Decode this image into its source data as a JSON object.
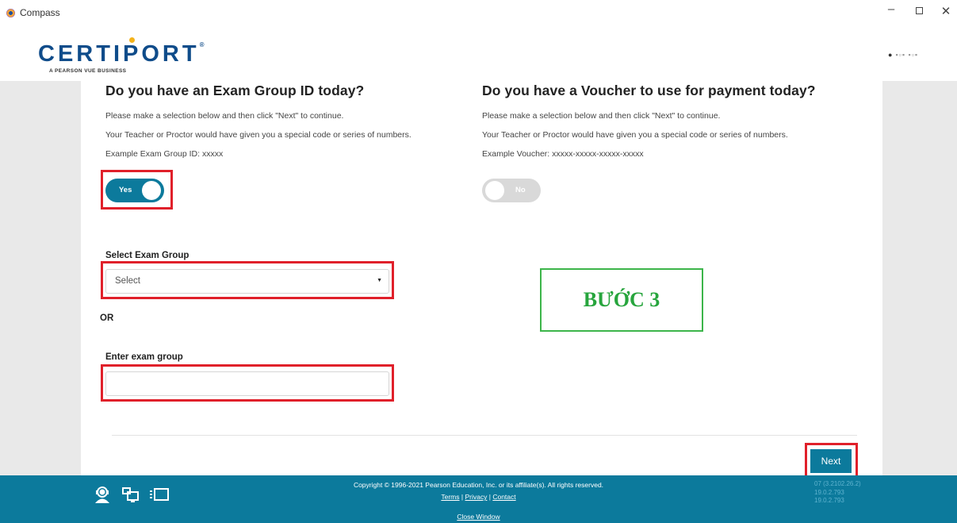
{
  "window": {
    "title": "Compass",
    "minimize_label": "–",
    "close_label": "✕"
  },
  "header": {
    "logo_text": "CERTIPORT",
    "logo_registered": "®",
    "logo_subtitle": "A PEARSON VUE BUSINESS",
    "user_name": "▪▫▪ ▪▫▪"
  },
  "exam_group": {
    "title": "Do you have an Exam Group ID today?",
    "instruction": "Please make a selection below and then click \"Next\" to continue.",
    "hint": "Your Teacher or Proctor would have given you a special code or series of numbers.",
    "example": "Example Exam Group ID: xxxxx",
    "toggle_label": "Yes",
    "toggle_on": true,
    "select_label": "Select Exam Group",
    "select_value": "Select",
    "or_label": "OR",
    "input_label": "Enter exam group",
    "input_value": ""
  },
  "voucher": {
    "title": "Do you have a Voucher to use for payment today?",
    "instruction": "Please make a selection below and then click \"Next\" to continue.",
    "hint": "Your Teacher or Proctor would have given you a special code or series of numbers.",
    "example": "Example Voucher: xxxxx-xxxxx-xxxxx-xxxxx",
    "toggle_label": "No",
    "toggle_on": false
  },
  "annotation": {
    "step_text": "BƯỚC 3",
    "highlight_color": "#e0202a",
    "step_color": "#27a53d"
  },
  "actions": {
    "next_label": "Next"
  },
  "footer": {
    "copyright": "Copyright © 1996-2021 Pearson Education, Inc. or its affiliate(s). All rights reserved.",
    "terms": "Terms",
    "privacy": "Privacy",
    "contact": "Contact",
    "separator": "|",
    "close_window": "Close Window",
    "versions": [
      "07 (3.2102.26.2)",
      "19.0.2.793",
      "19.0.2.793"
    ],
    "icons": [
      "support-agent-icon",
      "network-computer-icon",
      "screen-icon"
    ]
  },
  "theme": {
    "primary": "#0c7a9c",
    "gutter": "#e9e9e9"
  }
}
